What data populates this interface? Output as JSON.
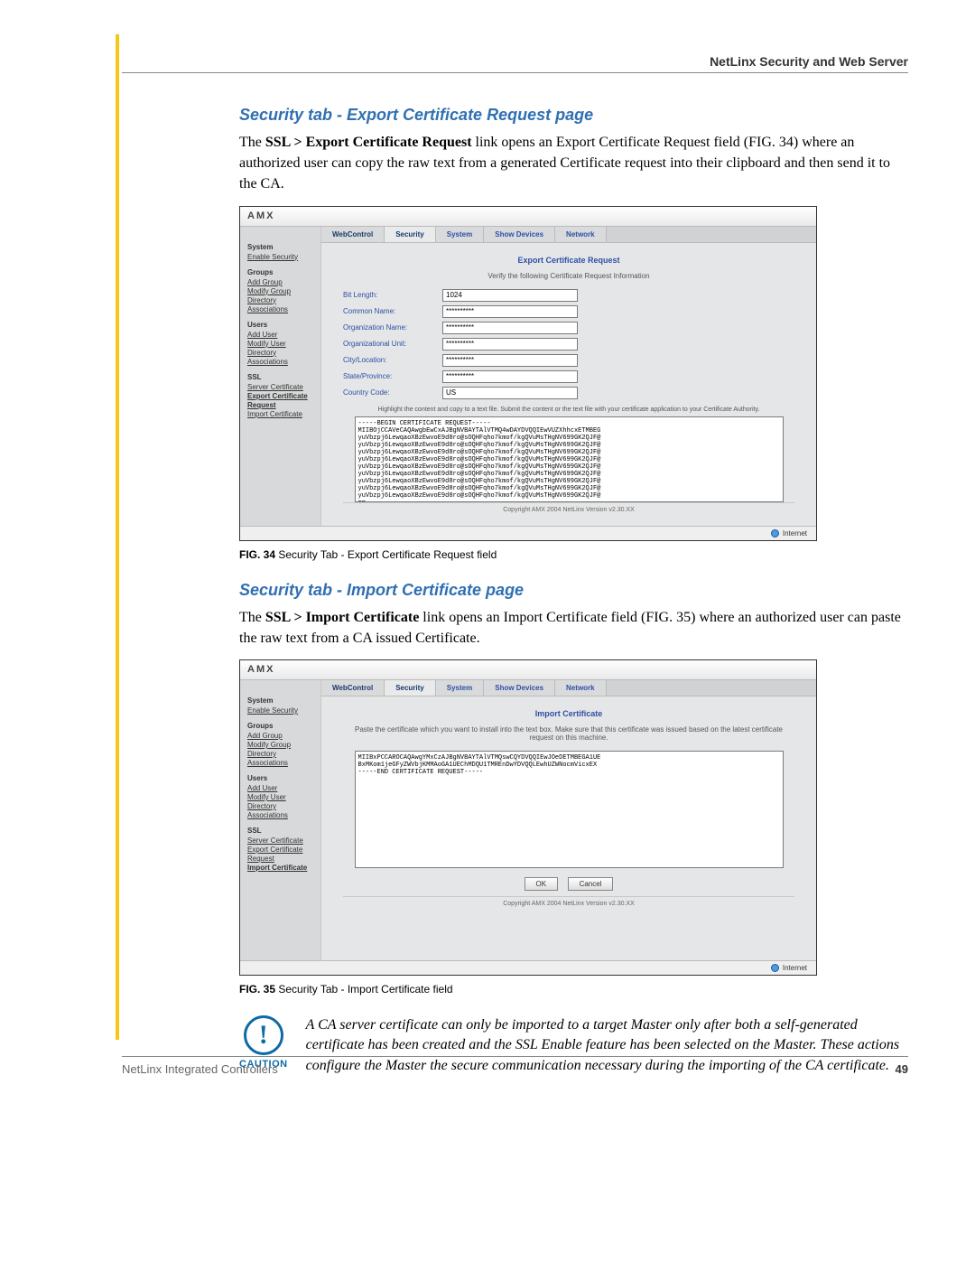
{
  "header": {
    "right_title": "NetLinx Security and Web Server"
  },
  "section1": {
    "title": "Security tab - Export Certificate Request page",
    "body_pre": "The ",
    "body_bold": "SSL > Export Certificate Request",
    "body_post": " link opens an Export Certificate Request field (FIG. 34) where an authorized user can copy the raw text from a generated Certificate request into their clipboard and then send it to the CA.",
    "caption_bold": "FIG. 34",
    "caption_post": "  Security Tab - Export Certificate Request field"
  },
  "section2": {
    "title": "Security tab - Import Certificate page",
    "body_pre": "The ",
    "body_bold": "SSL > Import Certificate",
    "body_post": " link opens an Import Certificate field (FIG. 35) where an authorized user can paste the raw text from a CA issued Certificate.",
    "caption_bold": "FIG. 35",
    "caption_post": "  Security Tab - Import Certificate field"
  },
  "caution": {
    "label": "CAUTION",
    "text": "A CA server certificate can only be imported to a target Master only after both a self-generated certificate has been created and the SSL Enable feature has been selected on the Master. These actions configure the Master the secure communication necessary during the importing of the CA certificate."
  },
  "footer": {
    "left": "NetLinx Integrated Controllers",
    "page": "49"
  },
  "screenshot_common": {
    "logo": "AMX",
    "tabs": [
      "WebControl",
      "Security",
      "System",
      "Show Devices",
      "Network"
    ],
    "side": {
      "system_h": "System",
      "enable_security": "Enable Security",
      "groups_h": "Groups",
      "add_group": "Add Group",
      "modify_group": "Modify Group",
      "directory": "Directory",
      "associations": "Associations",
      "users_h": "Users",
      "add_user": "Add User",
      "modify_user": "Modify User",
      "ssl_h": "SSL",
      "server_cert": "Server Certificate",
      "export_cert": "Export Certificate",
      "request": "Request",
      "import_cert": "Import Certificate"
    },
    "status_text": "Internet",
    "copyright": "Copyright AMX 2004   NetLinx Version v2.30.XX"
  },
  "export_panel": {
    "title": "Export Certificate Request",
    "subtitle": "Verify the following Certificate Request Information",
    "fields": {
      "bit_length_label": "Bit Length:",
      "bit_length_value": "1024",
      "common_name_label": "Common Name:",
      "common_name_value": "**********",
      "org_name_label": "Organization Name:",
      "org_name_value": "**********",
      "org_unit_label": "Organizational Unit:",
      "org_unit_value": "**********",
      "city_label": "City/Location:",
      "city_value": "**********",
      "state_label": "State/Province:",
      "state_value": "**********",
      "country_label": "Country Code:",
      "country_value": "US"
    },
    "note": "Highlight the content and copy to a text file. Submit the content or the text file with your certificate application to your Certificate Authority.",
    "textarea": "-----BEGIN CERTIFICATE REQUEST-----\nMIIBOjCCAVeCAQAwgbEwCxAJBgNVBAYTAlVTMQ4wDAYDVQQIEwVUZXhhcxETMBEG\nyuVbzpj6LewqaoXBzEwvoE9d8ro@sOQHFqho7kmof/kgQVuMsTHgNV699GK2QJF@\nyuVbzpj6LewqaoXBzEwvoE9d8ro@sOQHFqho7kmof/kgQVuMsTHgNV699GK2QJF@\nyuVbzpj6LewqaoXBzEwvoE9d8ro@sOQHFqho7kmof/kgQVuMsTHgNV699GK2QJF@\nyuVbzpj6LewqaoXBzEwvoE9d8ro@sOQHFqho7kmof/kgQVuMsTHgNV699GK2QJF@\nyuVbzpj6LewqaoXBzEwvoE9d8ro@sOQHFqho7kmof/kgQVuMsTHgNV699GK2QJF@\nyuVbzpj6LewqaoXBzEwvoE9d8ro@sOQHFqho7kmof/kgQVuMsTHgNV699GK2QJF@\nyuVbzpj6LewqaoXBzEwvoE9d8ro@sOQHFqho7kmof/kgQVuMsTHgNV699GK2QJF@\nyuVbzpj6LewqaoXBzEwvoE9d8ro@sOQHFqho7kmof/kgQVuMsTHgNV699GK2QJF@\nyuVbzpj6LewqaoXBzEwvoE9d8ro@sOQHFqho7kmof/kgQVuMsTHgNV699GK2QJF@\n=="
  },
  "import_panel": {
    "title": "Import Certificate",
    "subtitle": "Paste the certificate which you want to install into the text box. Make sure that this certificate was issued based on the latest certificate request on this machine.",
    "textarea": "MIIBxPCCAROCAQAwgYMxCzAJBgNVBAYTAlVTMQswCQYDVQQIEwJOeDETMBEGA1UE\nBxMKom1jeGFyZWVbjKMMAoGA1UEChMDQU1TMREnDwYDVQQLEwhUZWNocmVicxEX\n-----END CERTIFICATE REQUEST-----",
    "ok_label": "OK",
    "cancel_label": "Cancel"
  }
}
